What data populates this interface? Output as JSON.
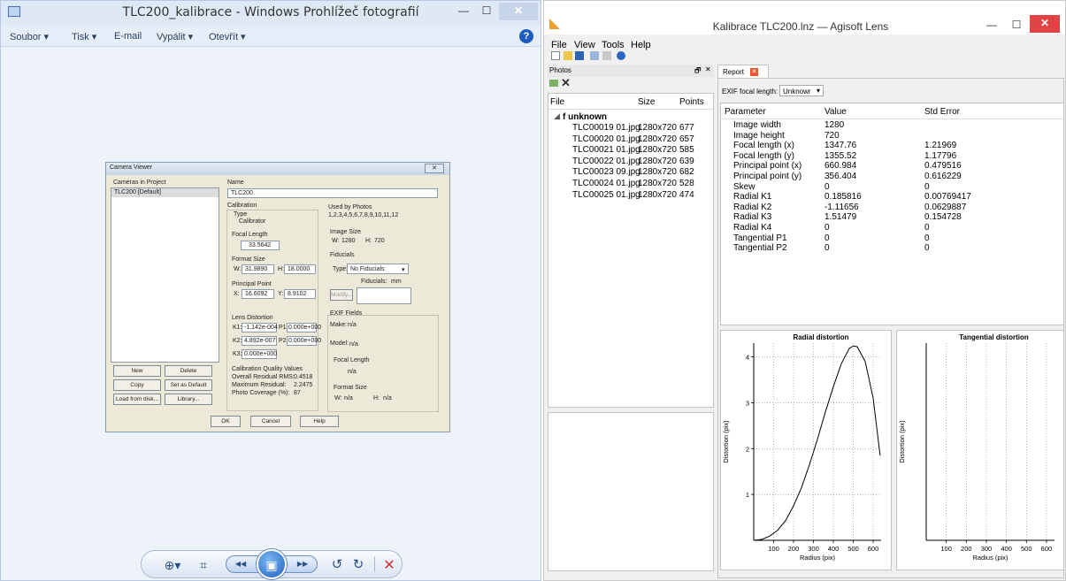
{
  "photo_viewer": {
    "title": "TLC200_kalibrace - Windows Prohlížeč fotografií",
    "menu": [
      "Soubor ▾",
      "Tisk ▾",
      "E-mail",
      "Vypálit ▾",
      "Otevřít ▾"
    ],
    "help": "?",
    "minimize": "—",
    "maximize": "☐",
    "close": "✕",
    "toolbar": {
      "zoom": "⊕▾",
      "fit": "⌗",
      "prev": "◀◀",
      "slideshow": "▣",
      "next": "▶▶",
      "rotate_ccw": "↺",
      "rotate_cw": "↻",
      "delete": "✕"
    }
  },
  "camera_viewer": {
    "title": "Camera Viewer",
    "close": "✕",
    "cameras_header": "Cameras in Project",
    "cameras": [
      "TLC200 [Default]"
    ],
    "name_label": "Name",
    "name_value": "TLC200",
    "calibration_label": "Calibration",
    "type_label": "Type",
    "type_value": "Calibrator",
    "focal_length_label": "Focal Length",
    "focal_length_value": "33.5642",
    "format_size_label": "Format Size",
    "format_w_label": "W:",
    "format_w_value": "31.9890",
    "format_h_label": "H:",
    "format_h_value": "18.0000",
    "principal_point_label": "Principal Point",
    "pp_x_label": "X:",
    "pp_x_value": "16.6092",
    "pp_y_label": "Y:",
    "pp_y_value": "8.9102",
    "lens_distortion_label": "Lens Distortion",
    "k1_label": "K1:",
    "k1_value": "-1.142e-004",
    "p1_label": "P1:",
    "p1_value": "0.000e+000",
    "k2_label": "K2:",
    "k2_value": "4.892e-007",
    "p2_label": "P2:",
    "p2_value": "0.000e+000",
    "k3_label": "K3:",
    "k3_value": "0.000e+000",
    "cq_label": "Calibration Quality Values",
    "rms_label": "Overall Residual RMS:",
    "rms_value": "0.4518",
    "max_res_label": "Maximum Residual:",
    "max_res_value": "2.2475",
    "coverage_label": "Photo Coverage (%):",
    "coverage_value": "87",
    "used_by_label": "Used by Photos",
    "used_by_value": "1,2,3,4,5,6,7,8,9,10,11,12",
    "image_size_label": "Image Size",
    "img_w_label": "W:",
    "img_w_value": "1280",
    "img_h_label": "H:",
    "img_h_value": "720",
    "fiducials_label": "Fiducials",
    "fid_type_label": "Type:",
    "fid_type_value": "No Fiducials",
    "fid_units_label": "Fiducials:",
    "fid_units_value": "mm",
    "modify_button": "Modify...",
    "exif_label": "EXIF Fields",
    "make_label": "Make:",
    "make_value": "n/a",
    "model_label": "Model:",
    "model_value": "n/a",
    "exif_fl_label": "Focal Length",
    "exif_fl_value": "n/a",
    "exif_fs_label": "Format Size",
    "exif_fs_w_label": "W:",
    "exif_fs_w_value": "n/a",
    "exif_fs_h_label": "H:",
    "exif_fs_h_value": "n/a",
    "buttons": {
      "new": "New",
      "delete": "Delete",
      "copy": "Copy",
      "set_default": "Set as Default",
      "load_disk": "Load from disk...",
      "library": "Library...",
      "ok": "OK",
      "cancel": "Cancel",
      "help": "Help"
    }
  },
  "agisoft": {
    "title": "Kalibrace TLC200.lnz — Agisoft Lens",
    "minimize": "—",
    "maximize": "☐",
    "close": "✕",
    "menu": [
      "File",
      "View",
      "Tools",
      "Help"
    ],
    "photos_panel": {
      "title": "Photos",
      "pin": "🗗",
      "close": "✕",
      "remove_icon": "✕",
      "columns": [
        "File",
        "Size",
        "Points"
      ],
      "group": "f unknown",
      "rows": [
        [
          "TLC00019 01.jpg",
          "1280x720",
          "677"
        ],
        [
          "TLC00020 01.jpg",
          "1280x720",
          "657"
        ],
        [
          "TLC00021 01.jpg",
          "1280x720",
          "585"
        ],
        [
          "TLC00022 01.jpg",
          "1280x720",
          "639"
        ],
        [
          "TLC00023 09.jpg",
          "1280x720",
          "682"
        ],
        [
          "TLC00024 01.jpg",
          "1280x720",
          "528"
        ],
        [
          "TLC00025 01.jpg",
          "1280x720",
          "474"
        ]
      ]
    },
    "report": {
      "tab": "Report",
      "exif_label": "EXIF focal length:",
      "exif_value": "Unknowr",
      "columns": [
        "Parameter",
        "Value",
        "Std Error"
      ],
      "rows": [
        [
          "Image width",
          "1280",
          ""
        ],
        [
          "Image height",
          "720",
          ""
        ],
        [
          "Focal length (x)",
          "1347.76",
          "1.21969"
        ],
        [
          "Focal length (y)",
          "1355.52",
          "1.17796"
        ],
        [
          "Principal point (x)",
          "660.984",
          "0.479516"
        ],
        [
          "Principal point (y)",
          "356.404",
          "0.616229"
        ],
        [
          "Skew",
          "0",
          "0"
        ],
        [
          "Radial K1",
          "0.185816",
          "0.00769417"
        ],
        [
          "Radial K2",
          "-1.11656",
          "0.0629887"
        ],
        [
          "Radial K3",
          "1.51479",
          "0.154728"
        ],
        [
          "Radial K4",
          "0",
          "0"
        ],
        [
          "Tangential P1",
          "0",
          "0"
        ],
        [
          "Tangential P2",
          "0",
          "0"
        ]
      ]
    }
  },
  "chart_data": [
    {
      "type": "line",
      "title": "Radial distortion",
      "xlabel": "Radius (pix)",
      "ylabel": "Distortion (pix)",
      "xlim": [
        0,
        640
      ],
      "ylim": [
        0,
        4.3
      ],
      "xticks": [
        100,
        200,
        300,
        400,
        500,
        600
      ],
      "yticks": [
        1,
        2,
        3,
        4
      ],
      "grid": true,
      "x": [
        0,
        40,
        80,
        120,
        160,
        200,
        240,
        280,
        320,
        360,
        400,
        440,
        480,
        500,
        520,
        560,
        600,
        635
      ],
      "y": [
        0,
        0.02,
        0.09,
        0.22,
        0.43,
        0.75,
        1.15,
        1.65,
        2.2,
        2.8,
        3.35,
        3.85,
        4.18,
        4.24,
        4.22,
        3.9,
        3.1,
        1.85
      ]
    },
    {
      "type": "line",
      "title": "Tangential distortion",
      "xlabel": "Radius (pix)",
      "ylabel": "Distortion (pix)",
      "xlim": [
        0,
        640
      ],
      "xticks": [
        100,
        200,
        300,
        400,
        500,
        600
      ],
      "grid": true,
      "x": [],
      "y": []
    }
  ]
}
